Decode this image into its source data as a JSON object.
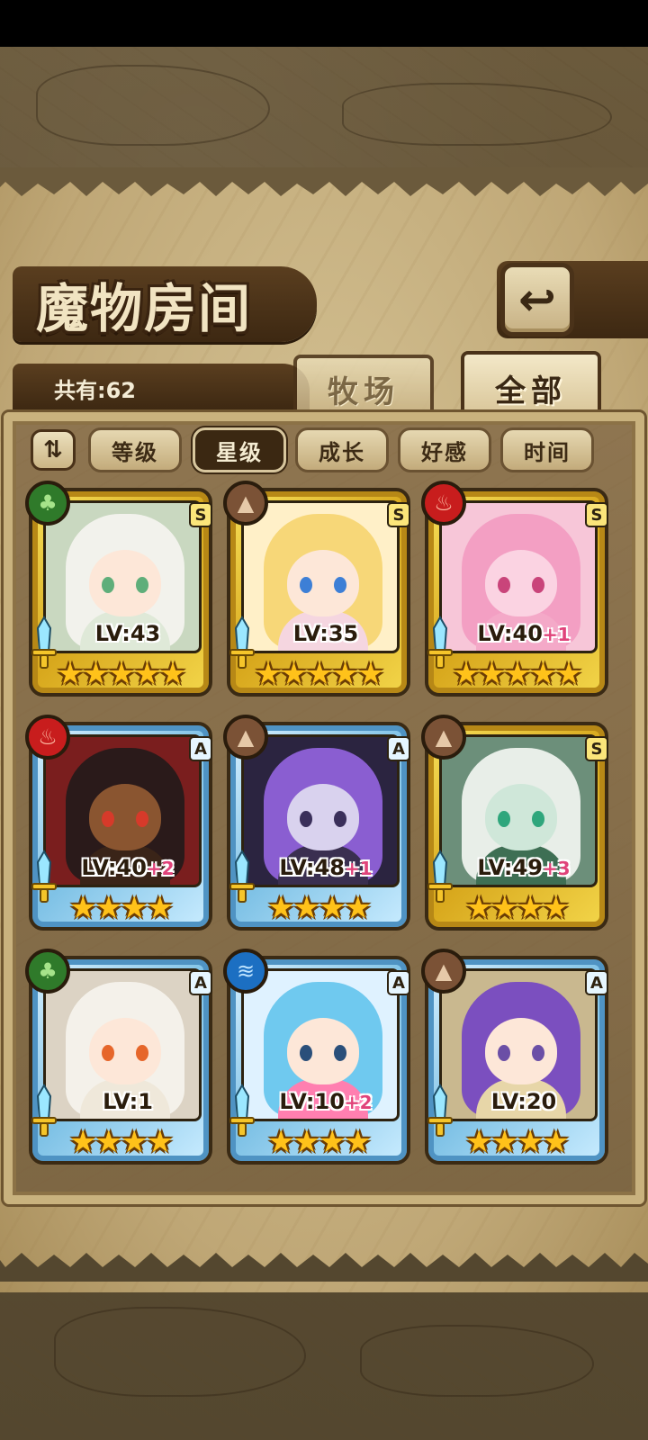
{
  "title": "魔物房间",
  "back_icon": "↩",
  "count": {
    "label": "共有:",
    "value": "62"
  },
  "tabs": {
    "ranch": "牧场",
    "all": "全部"
  },
  "sort": {
    "toggle_icon": "⇅",
    "buttons": [
      "等级",
      "星级",
      "成长",
      "好感",
      "时间"
    ],
    "active": "星级"
  },
  "cards": [
    {
      "rank": "S",
      "element": "grass",
      "level_label": "LV:43",
      "bonus": "",
      "stars": "★★★★★",
      "frame": "gold"
    },
    {
      "rank": "S",
      "element": "earth",
      "level_label": "LV:35",
      "bonus": "",
      "stars": "★★★★★",
      "frame": "gold"
    },
    {
      "rank": "S",
      "element": "fire",
      "level_label": "LV:40",
      "bonus": "+1",
      "stars": "★★★★★",
      "frame": "gold"
    },
    {
      "rank": "A",
      "element": "fire",
      "level_label": "LV:40",
      "bonus": "+2",
      "stars": "★★★★",
      "frame": "blue"
    },
    {
      "rank": "A",
      "element": "earth",
      "level_label": "LV:48",
      "bonus": "+1",
      "stars": "★★★★",
      "frame": "blue"
    },
    {
      "rank": "S",
      "element": "earth",
      "level_label": "LV:49",
      "bonus": "+3",
      "stars": "★★★★",
      "frame": "gold"
    },
    {
      "rank": "A",
      "element": "grass",
      "level_label": "LV:1",
      "bonus": "",
      "stars": "★★★★",
      "frame": "blue"
    },
    {
      "rank": "A",
      "element": "water",
      "level_label": "LV:10",
      "bonus": "+2",
      "stars": "★★★★",
      "frame": "blue"
    },
    {
      "rank": "A",
      "element": "earth",
      "level_label": "LV:20",
      "bonus": "",
      "stars": "★★★★",
      "frame": "blue"
    }
  ],
  "element_icons": {
    "grass": "♣",
    "earth": "▲",
    "fire": "♨",
    "water": "≋"
  },
  "colors": {
    "gold_frame": "#e8c233",
    "blue_frame": "#7fc2e6",
    "active_sort_bg": "#3b2812",
    "bonus_pink": "#e0437a"
  }
}
